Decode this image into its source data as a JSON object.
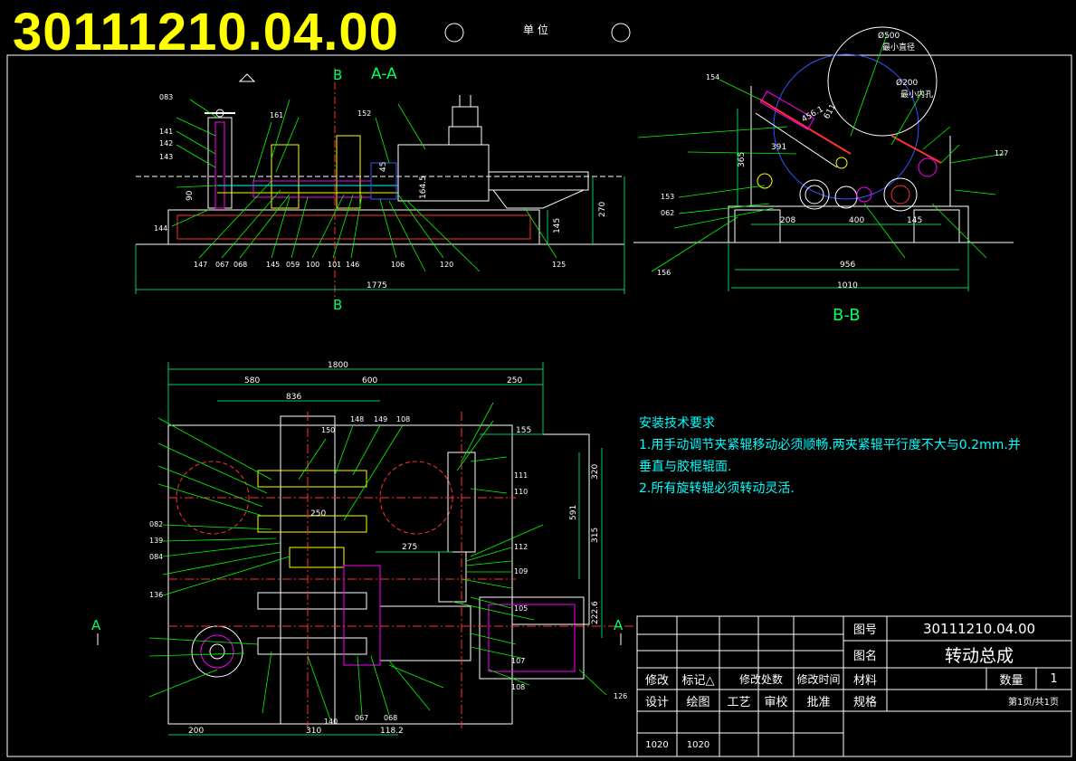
{
  "drawing_number_big": "30111210.04.00",
  "unit_text": "单  位",
  "views": {
    "section_aa": "A-A",
    "section_bb": "B-B",
    "mark_b_top": "B",
    "mark_b_bottom": "B",
    "mark_a_left": "A",
    "mark_a_right": "A"
  },
  "tech_requirements": {
    "title": "安装技术要求",
    "line1": "1.用手动调节夹紧辊移动必须顺畅.两夹紧辊平行度不大与0.2mm.并",
    "line2": "垂直与胶棍辊面.",
    "line3": "2.所有旋转辊必须转动灵活."
  },
  "title_block": {
    "drawing_no_label": "图号",
    "drawing_no": "30111210.04.00",
    "name_label": "图名",
    "name": "转动总成",
    "material_label": "材料",
    "quantity_label": "数量",
    "quantity": "1",
    "spec_label": "规格",
    "page": "第1页/共1页",
    "rev_headers": [
      "修改",
      "标记△",
      "修改处数",
      "修改时间"
    ],
    "sign_headers": [
      "设计",
      "绘图",
      "工艺",
      "审校",
      "批准"
    ],
    "dates": [
      "1020",
      "1020"
    ]
  },
  "dimensions": {
    "aa": [
      "1775",
      "270",
      "145",
      "90",
      "164.5",
      "45"
    ],
    "bb": [
      "1010",
      "956",
      "208",
      "400",
      "145",
      "365",
      "456.1",
      "611",
      "391"
    ],
    "bb_notes": [
      "Ø500",
      "最小直径",
      "Ø200",
      "最小内孔"
    ],
    "plan": [
      "1800",
      "580",
      "600",
      "250",
      "836",
      "155",
      "250",
      "275",
      "200",
      "310",
      "118.2",
      "320",
      "315",
      "591",
      "222.6"
    ]
  },
  "part_labels": {
    "aa_bottom": [
      "147",
      "067",
      "068",
      "145",
      "059",
      "100",
      "101",
      "146",
      "106",
      "120",
      "125"
    ],
    "aa_left": [
      "141",
      "142",
      "143",
      "144",
      "083"
    ],
    "aa_top": [
      "152",
      "161"
    ],
    "bb": [
      "154",
      "127",
      "153",
      "062",
      "156"
    ],
    "plan_left": [
      "082",
      "139",
      "084",
      "136"
    ],
    "plan_top": [
      "150",
      "148",
      "149",
      "108"
    ],
    "plan_right": [
      "111",
      "110",
      "112",
      "109",
      "105",
      "107",
      "108",
      "126"
    ],
    "plan_bottom": [
      "140",
      "067",
      "068"
    ]
  },
  "colors": {
    "background": "#000000",
    "frame": "#ffffff",
    "title_yellow": "#ffff00",
    "leader_green": "#00ff00",
    "dimension_green": "#00cc66",
    "text_cyan": "#00ffff",
    "part_magenta": "#ff00ff",
    "part_red": "#ff3030",
    "part_yellow": "#ffff00",
    "part_blue": "#3355ff"
  }
}
